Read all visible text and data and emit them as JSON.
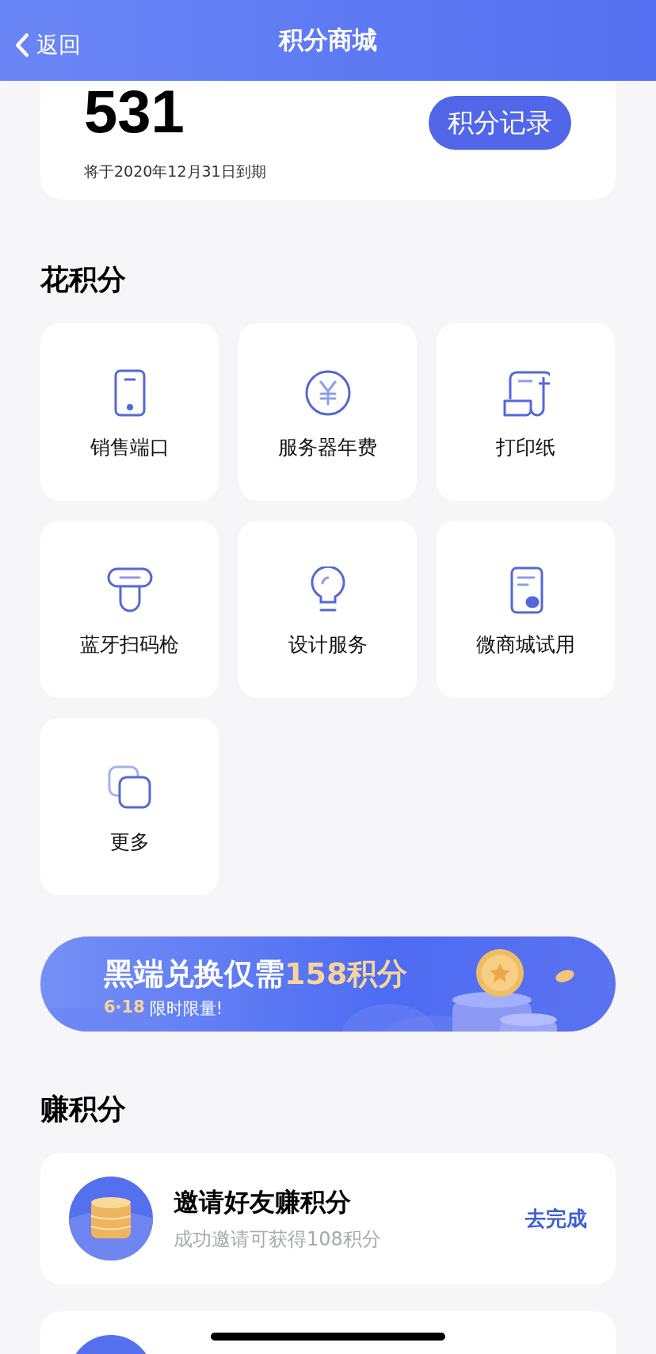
{
  "header": {
    "back": "返回",
    "title": "积分商城"
  },
  "points_card": {
    "value": "531",
    "expiry": "将于2020年12月31日到期",
    "button": "积分记录"
  },
  "spend": {
    "title": "花积分",
    "items": [
      {
        "kind": "phone",
        "label": "销售端口"
      },
      {
        "kind": "yen",
        "label": "服务器年费"
      },
      {
        "kind": "paper",
        "label": "打印纸"
      },
      {
        "kind": "scanner",
        "label": "蓝牙扫码枪"
      },
      {
        "kind": "bulb",
        "label": "设计服务"
      },
      {
        "kind": "chat",
        "label": "微商城试用"
      },
      {
        "kind": "more",
        "label": "更多"
      }
    ]
  },
  "banner": {
    "headline": "黑端兑换仅需",
    "highlight": "158积分",
    "date": "6·18",
    "subline": "限时限量!"
  },
  "earn": {
    "title": "赚积分",
    "tasks": [
      {
        "kind": "full",
        "title": "邀请好友赚积分",
        "description": "成功邀请可获得108积分",
        "action": "去完成"
      },
      {
        "kind": "icon_only"
      }
    ]
  }
}
